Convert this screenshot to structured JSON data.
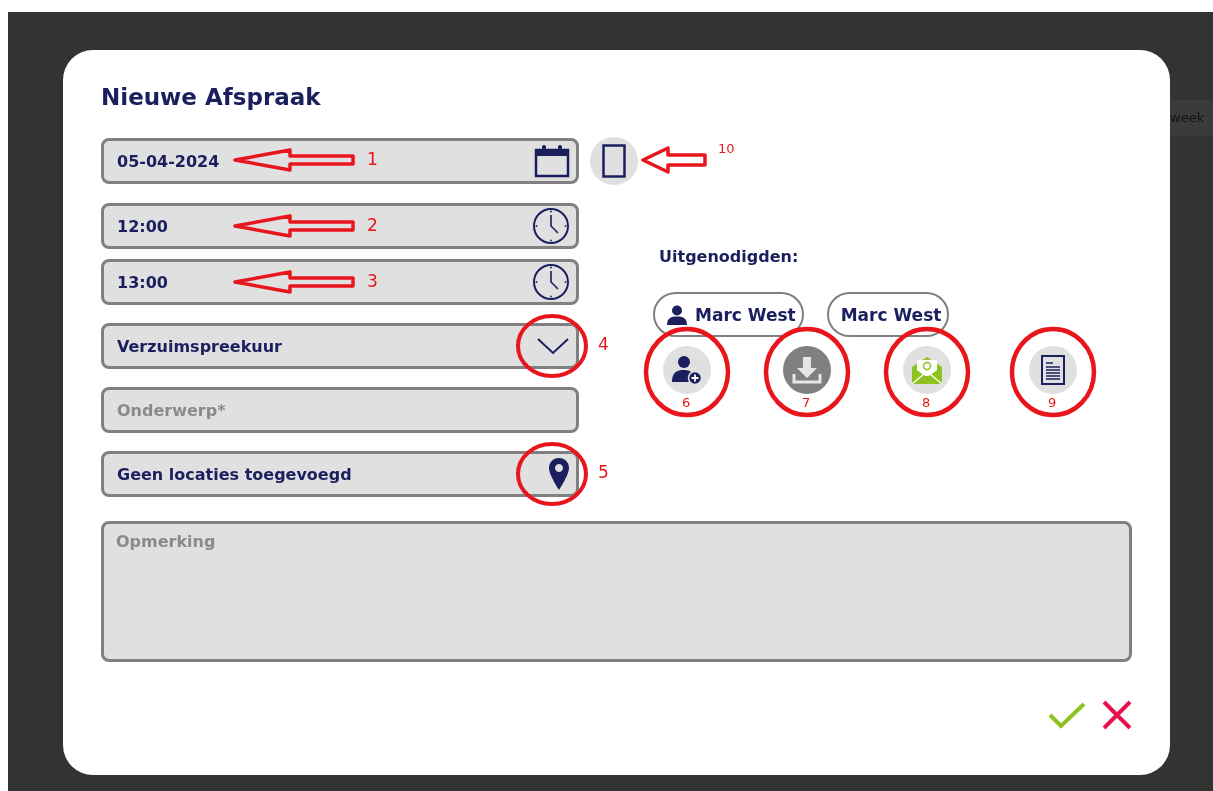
{
  "background": {
    "tab_text": "week"
  },
  "dialog": {
    "title": "Nieuwe Afspraak"
  },
  "fields": [
    {
      "kind": "date",
      "value": "05-04-2024",
      "annotation": {
        "kind": "arrow",
        "label": "1"
      }
    },
    {
      "kind": "time",
      "value": "12:00",
      "annotation": {
        "kind": "arrow",
        "label": "2"
      }
    },
    {
      "kind": "time",
      "value": "13:00",
      "annotation": {
        "kind": "arrow",
        "label": "3"
      }
    },
    {
      "kind": "select",
      "value": "Verzuimspreekuur",
      "annotation": {
        "kind": "circle",
        "label": "4"
      }
    },
    {
      "kind": "text",
      "placeholder": "Onderwerp*"
    },
    {
      "kind": "location",
      "value": "Geen locaties toegevoegd",
      "annotation": {
        "kind": "circle",
        "label": "5"
      }
    }
  ],
  "device_button": {
    "annotation": {
      "kind": "arrow",
      "label": "10"
    }
  },
  "invitees": {
    "label": "Uitgenodigden:",
    "chips": [
      {
        "name": "Marc West",
        "has_icon": true
      },
      {
        "name": "Marc West",
        "has_icon": false
      }
    ]
  },
  "actions": [
    {
      "kind": "add-person",
      "annotation": {
        "kind": "circle",
        "label": "6"
      }
    },
    {
      "kind": "download",
      "annotation": {
        "kind": "circle",
        "label": "7"
      }
    },
    {
      "kind": "email",
      "annotation": {
        "kind": "circle",
        "label": "8"
      }
    },
    {
      "kind": "document",
      "annotation": {
        "kind": "circle",
        "label": "9"
      }
    }
  ],
  "remark": {
    "placeholder": "Opmerking"
  },
  "footer": {
    "buttons": [
      {
        "kind": "confirm"
      },
      {
        "kind": "cancel"
      }
    ]
  }
}
